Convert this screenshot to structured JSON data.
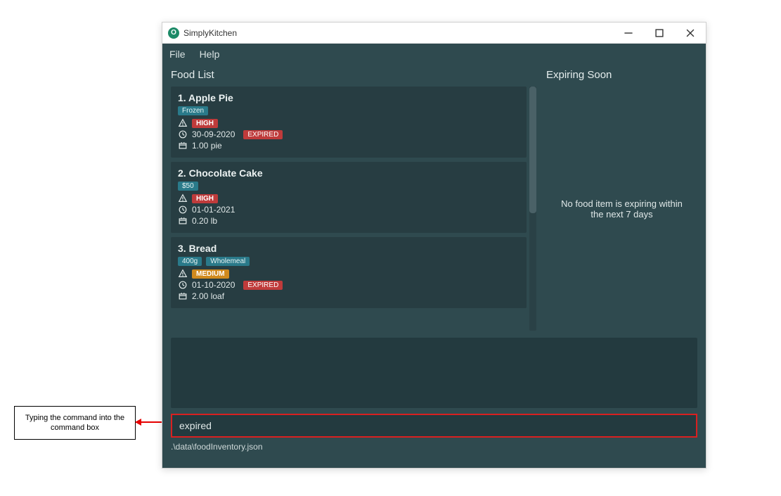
{
  "annotation": {
    "text": "Typing the command into the command box"
  },
  "titlebar": {
    "app_name": "SimplyKitchen",
    "icon_letter": "O"
  },
  "menubar": {
    "file": "File",
    "help": "Help"
  },
  "panels": {
    "food_list_title": "Food List",
    "expiring_title": "Expiring Soon",
    "expiring_message": "No food item is expiring within the next 7 days"
  },
  "food_items": [
    {
      "index": "1.",
      "name": "Apple Pie",
      "tags": [
        "Frozen"
      ],
      "priority": "HIGH",
      "priority_class": "priority-high",
      "date": "30-09-2020",
      "expired": "EXPIRED",
      "quantity": "1.00 pie"
    },
    {
      "index": "2.",
      "name": "Chocolate Cake",
      "tags": [
        "$50"
      ],
      "priority": "HIGH",
      "priority_class": "priority-high",
      "date": "01-01-2021",
      "expired": "",
      "quantity": "0.20 lb"
    },
    {
      "index": "3.",
      "name": "Bread",
      "tags": [
        "400g",
        "Wholemeal"
      ],
      "priority": "MEDIUM",
      "priority_class": "priority-medium",
      "date": "01-10-2020",
      "expired": "EXPIRED",
      "quantity": "2.00 loaf"
    }
  ],
  "command": {
    "value": "expired"
  },
  "statusbar": {
    "path": ".\\data\\foodInventory.json"
  }
}
